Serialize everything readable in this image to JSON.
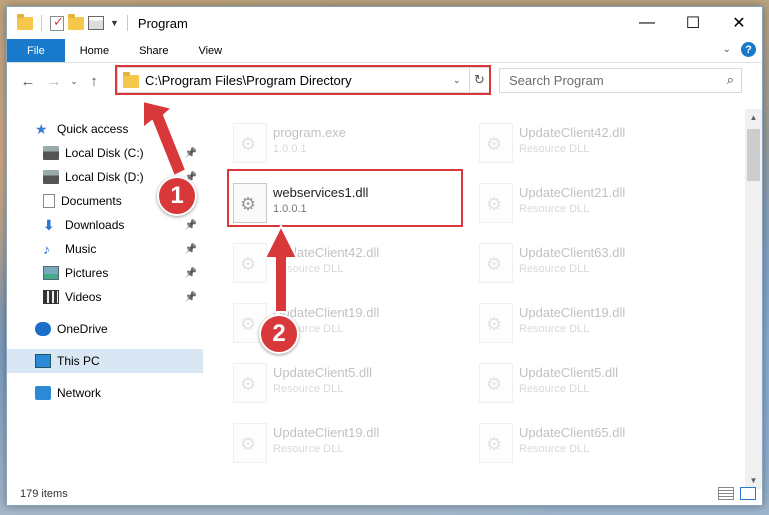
{
  "window": {
    "title": "Program",
    "controls": [
      "—",
      "☐",
      "✕"
    ]
  },
  "ribbon": {
    "tabs": [
      "File",
      "Home",
      "Share",
      "View"
    ]
  },
  "address_bar": {
    "path": "C:\\Program Files\\Program Directory",
    "search_placeholder": "Search Program"
  },
  "sidebar": {
    "items": [
      {
        "label": "Quick access",
        "icon": "star-icon",
        "pinned": false
      },
      {
        "label": "Local Disk (C:)",
        "icon": "disk-icon",
        "pinned": true
      },
      {
        "label": "Local Disk (D:)",
        "icon": "disk-icon",
        "pinned": true
      },
      {
        "label": "Documents",
        "icon": "documents-icon",
        "pinned": true
      },
      {
        "label": "Downloads",
        "icon": "downloads-icon",
        "pinned": true
      },
      {
        "label": "Music",
        "icon": "music-icon",
        "pinned": true
      },
      {
        "label": "Pictures",
        "icon": "pictures-icon",
        "pinned": true
      },
      {
        "label": "Videos",
        "icon": "videos-icon",
        "pinned": true
      },
      {
        "label": "OneDrive",
        "icon": "onedrive-icon",
        "pinned": false
      },
      {
        "label": "This PC",
        "icon": "this-pc-icon",
        "pinned": false,
        "selected": true
      },
      {
        "label": "Network",
        "icon": "network-icon",
        "pinned": false
      }
    ]
  },
  "files": [
    {
      "name": "program.exe",
      "desc": "1.0.0.1",
      "faded": true
    },
    {
      "name": "UpdateClient42.dll",
      "desc": "Resource DLL",
      "faded": true
    },
    {
      "name": "webservices1.dll",
      "desc": "1.0.0.1",
      "faded": false
    },
    {
      "name": "UpdateClient21.dll",
      "desc": "Resource DLL",
      "faded": true
    },
    {
      "name": "UpdateClient42.dll",
      "desc": "Resource DLL",
      "faded": true
    },
    {
      "name": "UpdateClient63.dll",
      "desc": "Resource DLL",
      "faded": true
    },
    {
      "name": "UpdateClient19.dll",
      "desc": "Resource DLL",
      "faded": true
    },
    {
      "name": "UpdateClient19.dll",
      "desc": "Resource DLL",
      "faded": true
    },
    {
      "name": "UpdateClient5.dll",
      "desc": "Resource DLL",
      "faded": true
    },
    {
      "name": "UpdateClient5.dll",
      "desc": "Resource DLL",
      "faded": true
    },
    {
      "name": "UpdateClient19.dll",
      "desc": "Resource DLL",
      "faded": true
    },
    {
      "name": "UpdateClient65.dll",
      "desc": "Resource DLL",
      "faded": true
    }
  ],
  "status": {
    "item_count": "179 items"
  },
  "annotations": {
    "step1": "1",
    "step2": "2",
    "color": "#d8383a"
  }
}
